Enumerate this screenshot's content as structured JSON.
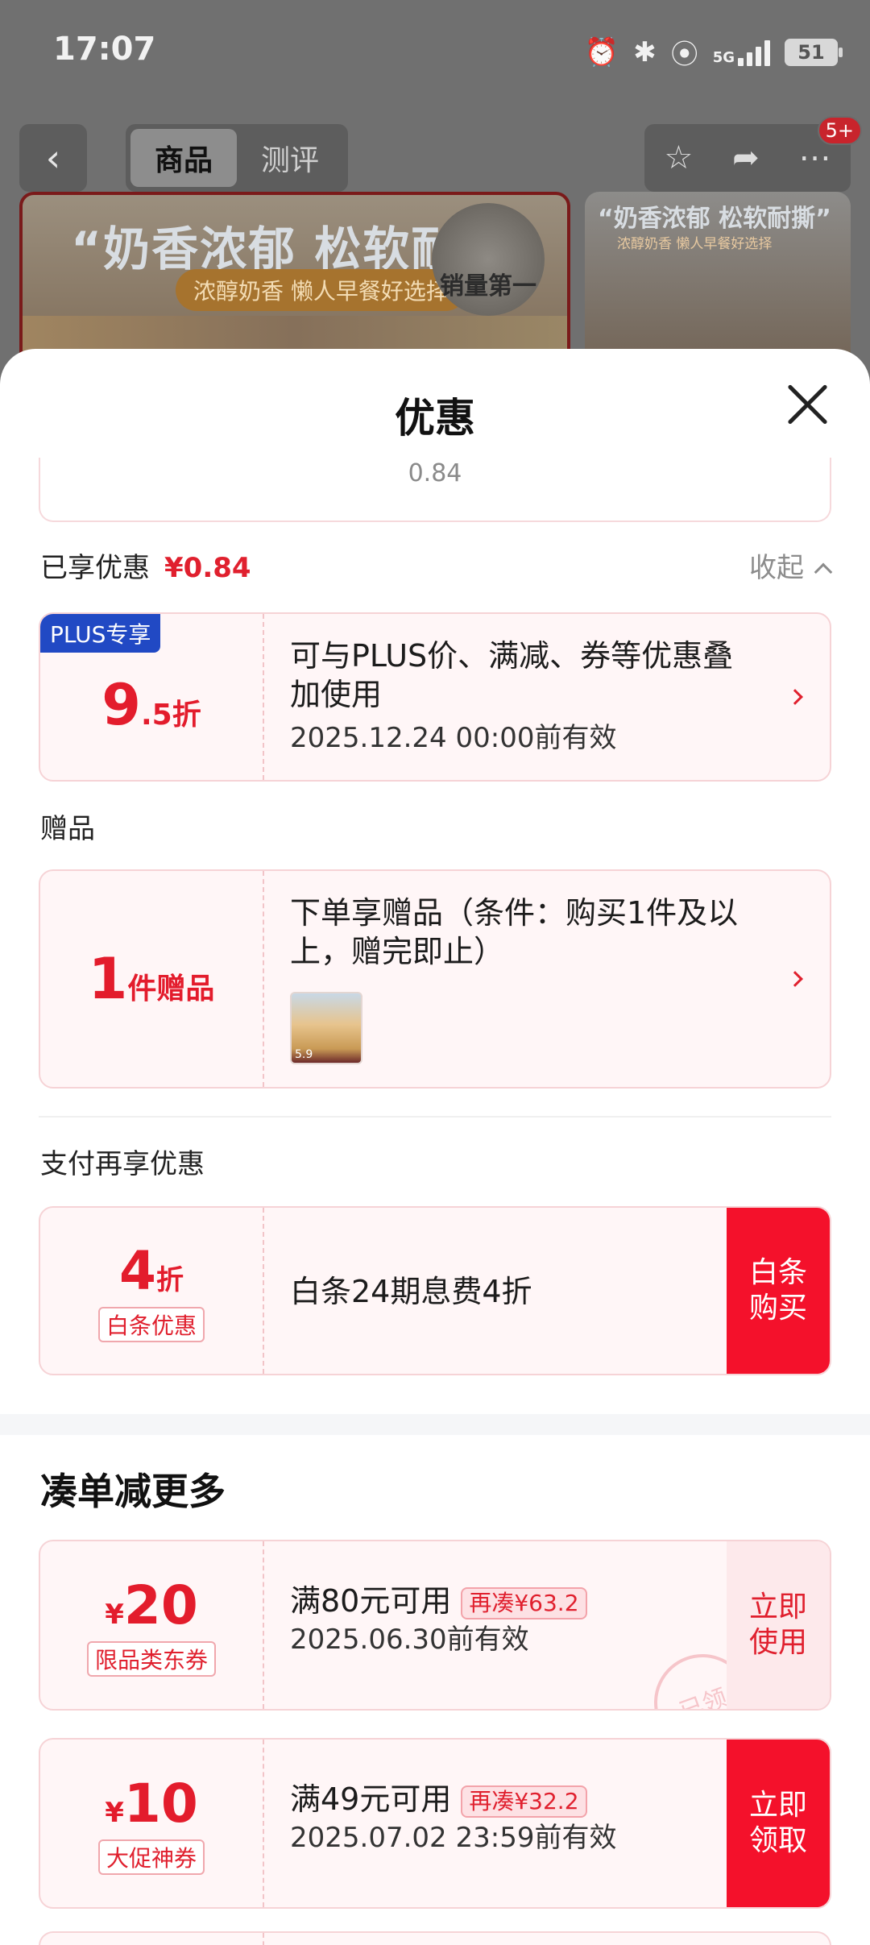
{
  "status_bar": {
    "time": "17:07",
    "signal": "5G",
    "battery": "51",
    "icons": [
      "alarm-icon",
      "bluetooth-icon",
      "location-icon",
      "signal-icon",
      "battery-icon"
    ]
  },
  "product_nav": {
    "tabs": [
      "商品",
      "测评"
    ],
    "active_tab": "商品",
    "badge": "5+",
    "icons": [
      "back-icon",
      "star-icon",
      "share-icon",
      "more-icon"
    ]
  },
  "background_banner": {
    "headline": "“奶香浓郁 松软耐",
    "subline": "浓醇奶香 懒人早餐好选择",
    "seal_text": "销量第一",
    "headline2": "“奶香浓郁 松软耐撕”",
    "subline2": "浓醇奶香 懒人早餐好选择"
  },
  "sheet": {
    "title": "优惠",
    "previous_value": "0.84",
    "enjoyed": {
      "label": "已享优惠",
      "amount": "¥0.84",
      "collapse_label": "收起"
    },
    "plus_coupon": {
      "tag": "PLUS专享",
      "discount_main": "9",
      "discount_sub": ".5折",
      "description": "可与PLUS价、满减、券等优惠叠加使用",
      "validity": "2025.12.24 00:00前有效"
    },
    "gift_section": {
      "label": "赠品",
      "count_main": "1",
      "count_sub": "件赠品",
      "description": "下单享赠品（条件：购买1件及以上，赠完即止）",
      "thumb_caption": "5.9"
    },
    "pay_section": {
      "label": "支付再享优惠",
      "discount_main": "4",
      "discount_sub": "折",
      "tag": "白条优惠",
      "description": "白条24期息费4折",
      "action": "白条购买"
    },
    "more_section": {
      "heading": "凑单减更多",
      "coupons": [
        {
          "currency": "¥",
          "amount": "20",
          "type_tag": "限品类东券",
          "condition": "满80元可用",
          "need_more": "再凑¥63.2",
          "validity": "2025.06.30前有效",
          "action": "立即使用",
          "stamp": "已领"
        },
        {
          "currency": "¥",
          "amount": "10",
          "type_tag": "大促神券",
          "condition": "满49元可用",
          "need_more": "再凑¥32.2",
          "validity": "2025.07.02 23:59前有效",
          "action": "立即领取"
        }
      ]
    }
  },
  "colors": {
    "accent_red": "#f4112b",
    "price_red": "#e31c2c",
    "plus_blue": "#2149c4",
    "coupon_bg": "#fff6f7"
  }
}
